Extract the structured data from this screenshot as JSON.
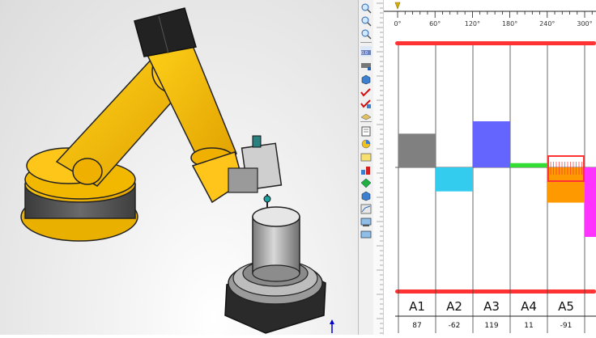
{
  "toolbar": {
    "icons": [
      "zoom-in-icon",
      "zoom-area-icon",
      "zoom-out-icon",
      "gauge-icon",
      "gauge-2-icon",
      "cube-icon",
      "checkmark-icon",
      "checkmark-2-icon",
      "plane-icon",
      "document-icon",
      "cube-2-icon",
      "table-icon",
      "pie-icon",
      "note-icon",
      "layers-icon",
      "diamond-icon",
      "cube-3-icon",
      "screen-icon",
      "screen-2-icon",
      "chart-icon"
    ]
  },
  "angle_ruler": {
    "ticks": [
      "0°",
      "60°",
      "120°",
      "180°",
      "240°",
      "300°"
    ]
  },
  "chart_data": {
    "type": "bar",
    "categories": [
      "A1",
      "A2",
      "A3",
      "A4",
      "A5"
    ],
    "values": [
      87,
      -62,
      119,
      11,
      -91
    ],
    "value_labels": [
      "87",
      "-62",
      "119",
      "11",
      "-91"
    ],
    "colors": [
      "#808080",
      "#33ccee",
      "#6464ff",
      "#33dd33",
      "#ff9900",
      "#ff33ff"
    ],
    "ylim": [
      -290,
      290
    ],
    "highlight_category": "A5",
    "limit_color": "#ff3333"
  }
}
